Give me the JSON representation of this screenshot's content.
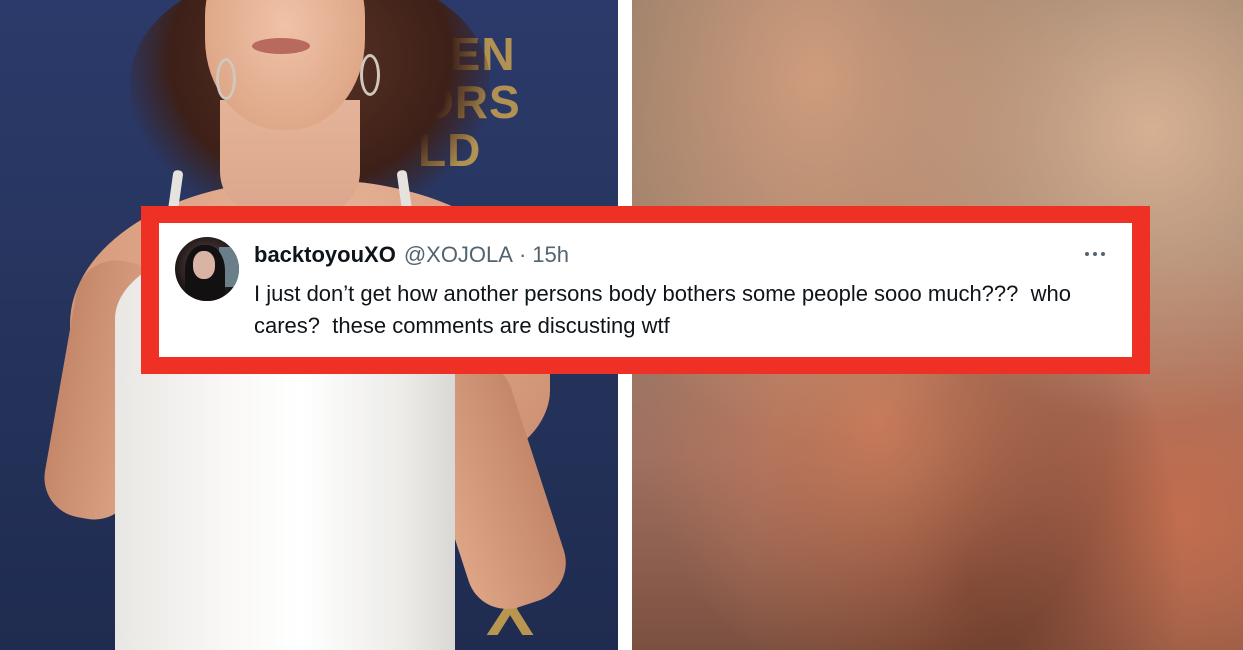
{
  "background": {
    "backdrop_letters": [
      "EEN",
      "ORS",
      "LD"
    ],
    "backdrop_x": "X",
    "frame_color": "#ee3124"
  },
  "tweet": {
    "display_name": "backtoyouXO",
    "handle": "@XOJOLA",
    "separator": "·",
    "time": "15h",
    "more_icon": "more-horizontal-icon",
    "text": "I just don’t get how another persons body bothers some people sooo much???  who cares?  these comments are discusting wtf"
  }
}
